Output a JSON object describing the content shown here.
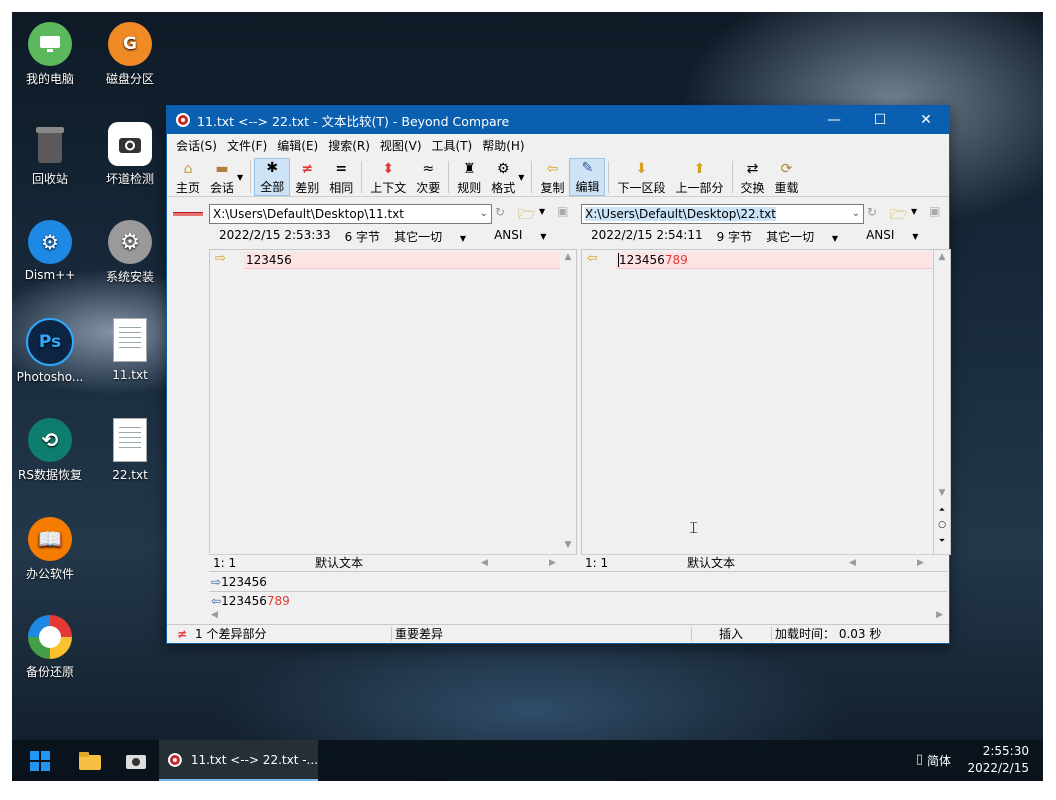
{
  "desktop": {
    "icons": [
      {
        "label": "我的电脑"
      },
      {
        "label": "磁盘分区"
      },
      {
        "label": "回收站"
      },
      {
        "label": "坏道检测"
      },
      {
        "label": "Dism++"
      },
      {
        "label": "系统安装"
      },
      {
        "label": "Photosho..."
      },
      {
        "label": "11.txt"
      },
      {
        "label": "RS数据恢复"
      },
      {
        "label": "22.txt"
      },
      {
        "label": "办公软件"
      },
      {
        "label": "备份还原"
      }
    ],
    "ps_glyph": "Ps",
    "g_glyph": "G"
  },
  "window": {
    "title": "11.txt <--> 22.txt - 文本比较(T) - Beyond Compare",
    "menu": [
      "会话(S)",
      "文件(F)",
      "编辑(E)",
      "搜索(R)",
      "视图(V)",
      "工具(T)",
      "帮助(H)"
    ],
    "toolbar": {
      "home": "主页",
      "session": "会话",
      "all": "全部",
      "diffs": "差别",
      "same": "相同",
      "context": "上下文",
      "minor": "次要",
      "rules": "规则",
      "format": "格式",
      "copy": "复制",
      "edit": "编辑",
      "next_section": "下一区段",
      "prev_section": "上一部分",
      "swap": "交换",
      "reload": "重载"
    },
    "left": {
      "path": "X:\\Users\\Default\\Desktop\\11.txt",
      "timestamp": "2022/2/15 2:53:33",
      "size": "6 字节",
      "filter": "其它一切",
      "encoding": "ANSI",
      "content": "123456",
      "position": "1: 1",
      "format_label": "默认文本"
    },
    "right": {
      "path": "X:\\Users\\Default\\Desktop\\22.txt",
      "timestamp": "2022/2/15 2:54:11",
      "size": "9 字节",
      "filter": "其它一切",
      "encoding": "ANSI",
      "content_common": "123456",
      "content_diff": "789",
      "position": "1: 1",
      "format_label": "默认文本"
    },
    "compare": {
      "line1": "123456",
      "line2_common": "123456",
      "line2_diff": "789"
    },
    "status": {
      "diff_count": "1 个差异部分",
      "importance": "重要差异",
      "mode": "插入",
      "load_time": "加载时间： 0.03 秒"
    }
  },
  "taskbar": {
    "active_task": "11.txt <--> 22.txt -...",
    "ime": "简体",
    "time": "2:55:30",
    "date": "2022/2/15"
  },
  "colors": {
    "titlebar": "#0a5fb0",
    "diff_bg": "#fde4e4",
    "diff_text": "#e53935"
  }
}
